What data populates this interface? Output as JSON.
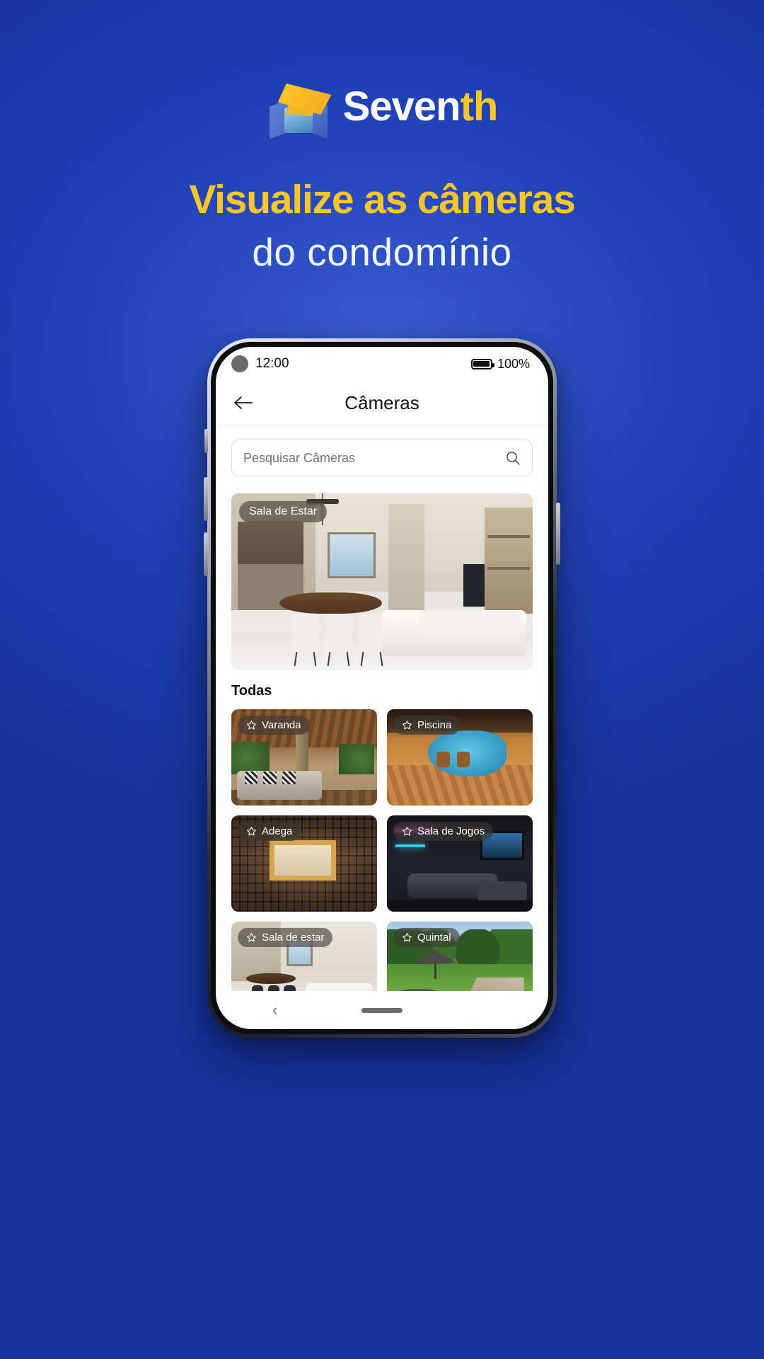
{
  "brand": {
    "name_white": "Seven",
    "name_yellow": "th",
    "accent_yellow": "#ffc627",
    "bg_blue": "#1c3fb0",
    "logo_icon": "seventh-cube-logo"
  },
  "headline": {
    "line1": "Visualize as câmeras",
    "line2": "do condomínio"
  },
  "phone": {
    "status_bar": {
      "time": "12:00",
      "battery_percent": "100%",
      "battery_icon": "battery-full-icon",
      "camera_icon": "front-camera-dot"
    },
    "app_bar": {
      "back_icon": "arrow-left-icon",
      "title": "Câmeras"
    },
    "search": {
      "placeholder": "Pesquisar Câmeras",
      "value": "",
      "icon": "search-icon"
    },
    "featured": {
      "label": "Sala de Estar",
      "scene": "living-room"
    },
    "section": {
      "title": "Todas"
    },
    "cameras": [
      {
        "label": "Varanda",
        "scene": "varanda",
        "favorite_icon": "star-outline-icon"
      },
      {
        "label": "Piscina",
        "scene": "piscina",
        "favorite_icon": "star-outline-icon"
      },
      {
        "label": "Adega",
        "scene": "adega",
        "favorite_icon": "star-outline-icon"
      },
      {
        "label": "Sala de Jogos",
        "scene": "jogos",
        "favorite_icon": "star-outline-icon"
      },
      {
        "label": "Sala de estar",
        "scene": "living2",
        "favorite_icon": "star-outline-icon"
      },
      {
        "label": "Quintal",
        "scene": "quintal",
        "favorite_icon": "star-outline-icon"
      }
    ],
    "nav_bar": {
      "back_glyph": "‹",
      "home_indicator": "home-pill"
    }
  }
}
